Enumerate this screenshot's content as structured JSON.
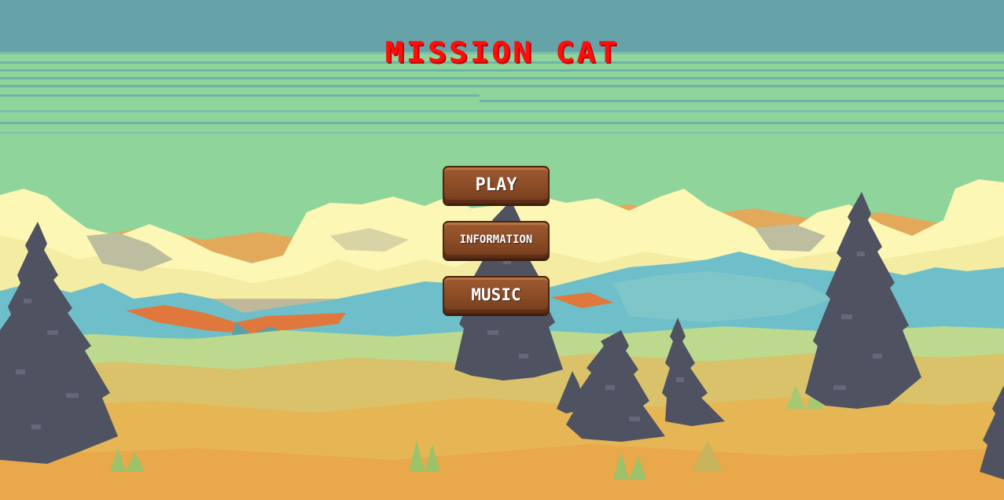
{
  "game": {
    "title": "MISSION CAT"
  },
  "menu": {
    "play_label": "PLAY",
    "information_label": "INFORMATION",
    "music_label": "MUSIC"
  },
  "colors": {
    "sky_top": "#66a3a8",
    "sky_band": "#8fd49a",
    "cloud": "#fcf7b4",
    "mountain": "#6ebfc9",
    "tree": "#4f5361",
    "grass": "#d9c26a",
    "title": "#ff0d0d",
    "button": "#8a4b26"
  }
}
